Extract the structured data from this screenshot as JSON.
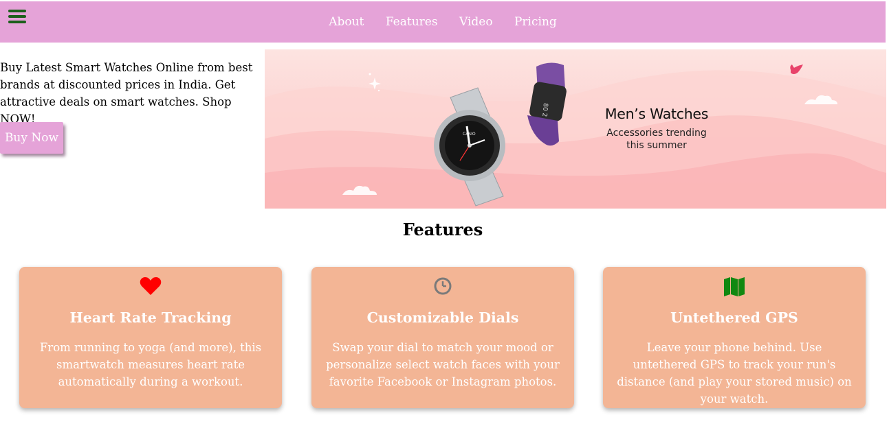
{
  "nav": {
    "links": [
      "About",
      "Features",
      "Video",
      "Pricing"
    ]
  },
  "hero": {
    "text": "Buy Latest Smart Watches Online from best brands at discounted prices in India. Get attractive deals on smart watches. Shop NOW!",
    "button": "Buy Now"
  },
  "banner": {
    "title": "Men’s Watches",
    "subtitle_line1": "Accessories trending",
    "subtitle_line2": "this summer",
    "tracker_display": "80 2",
    "brand_mark": "CASIO"
  },
  "features": {
    "heading": "Features",
    "cards": [
      {
        "icon": "heart-icon",
        "icon_color": "#ff0000",
        "title": "Heart Rate Tracking",
        "text": "From running to yoga (and more), this smartwatch measures heart rate automatically during a workout."
      },
      {
        "icon": "clock-icon",
        "icon_color": "#7a7a7a",
        "title": "Customizable Dials",
        "text": "Swap your dial to match your mood or personalize select watch faces with your favorite Facebook or Instagram photos."
      },
      {
        "icon": "map-icon",
        "icon_color": "#118811",
        "title": "Untethered GPS",
        "text": "Leave your phone behind. Use untethered GPS to track your run's distance (and play your stored music) on your watch."
      }
    ]
  },
  "colors": {
    "navbar": "#e5a3d8",
    "card_background": "#f3b595",
    "hamburger": "#1c5f1c"
  }
}
